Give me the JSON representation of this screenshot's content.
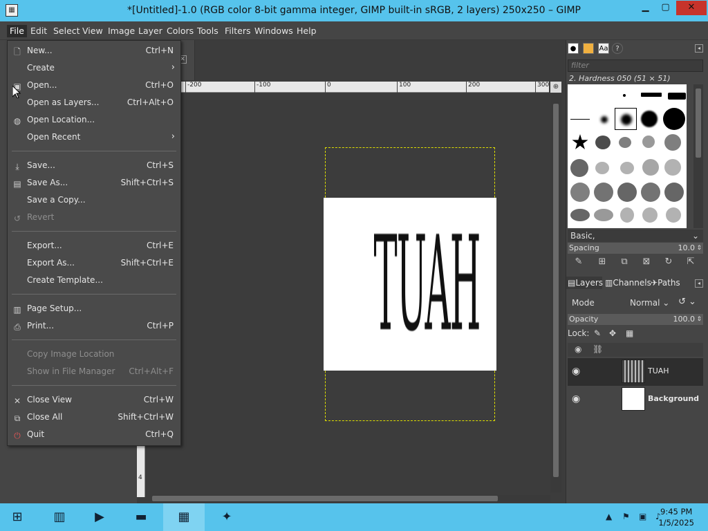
{
  "window": {
    "title": "*[Untitled]-1.0 (RGB color 8-bit gamma integer, GIMP built-in sRGB, 2 layers) 250x250 – GIMP",
    "minimize": "▁",
    "maximize": "▢",
    "close": "✕"
  },
  "menubar": [
    "File",
    "Edit",
    "Select",
    "View",
    "Image",
    "Layer",
    "Colors",
    "Tools",
    "Filters",
    "Windows",
    "Help"
  ],
  "file_menu": {
    "items": [
      {
        "label": "New...",
        "accel": "Ctrl+N",
        "icon": "new-image-icon"
      },
      {
        "label": "Create",
        "accel": "",
        "submenu": true
      },
      {
        "label": "Open...",
        "accel": "Ctrl+O",
        "icon": "open-icon"
      },
      {
        "label": "Open as Layers...",
        "accel": "Ctrl+Alt+O"
      },
      {
        "label": "Open Location...",
        "accel": "",
        "icon": "globe-icon"
      },
      {
        "label": "Open Recent",
        "accel": "",
        "submenu": true
      },
      {
        "label": "Save...",
        "accel": "Ctrl+S",
        "icon": "save-icon"
      },
      {
        "label": "Save As...",
        "accel": "Shift+Ctrl+S",
        "icon": "save-as-icon"
      },
      {
        "label": "Save a Copy...",
        "accel": ""
      },
      {
        "label": "Revert",
        "accel": "",
        "disabled": true,
        "icon": "revert-icon"
      },
      {
        "label": "Export...",
        "accel": "Ctrl+E"
      },
      {
        "label": "Export As...",
        "accel": "Shift+Ctrl+E"
      },
      {
        "label": "Create Template...",
        "accel": ""
      },
      {
        "label": "Page Setup...",
        "accel": "",
        "icon": "page-setup-icon"
      },
      {
        "label": "Print...",
        "accel": "Ctrl+P",
        "icon": "print-icon"
      },
      {
        "label": "Copy Image Location",
        "accel": "",
        "disabled": true
      },
      {
        "label": "Show in File Manager",
        "accel": "Ctrl+Alt+F",
        "disabled": true
      },
      {
        "label": "Close View",
        "accel": "Ctrl+W",
        "icon": "close-icon"
      },
      {
        "label": "Close All",
        "accel": "Shift+Ctrl+W",
        "icon": "close-all-icon"
      },
      {
        "label": "Quit",
        "accel": "Ctrl+Q",
        "icon": "quit-icon"
      }
    ],
    "submenu_glyph": "›"
  },
  "rulers": {
    "top": [
      "-200",
      "-100",
      "0",
      "100",
      "200",
      "300"
    ],
    "left_bottom": "4"
  },
  "image": {
    "text": "TUAH"
  },
  "brushes": {
    "filter_placeholder": "filter",
    "current_brush": "2. Hardness 050 (51 × 51)",
    "preset": "Basic,",
    "spacing_label": "Spacing",
    "spacing_value": "10.0"
  },
  "layers_panel": {
    "tabs": [
      "Layers",
      "Channels",
      "Paths"
    ],
    "mode_label": "Mode",
    "mode_value": "Normal",
    "opacity_label": "Opacity",
    "opacity_value": "100.0",
    "lock_label": "Lock:",
    "layers": [
      {
        "name": "TUAH",
        "selected": true
      },
      {
        "name": "Background",
        "selected": false
      }
    ]
  },
  "taskbar": {
    "time": "9:45 PM",
    "date": "1/5/2025"
  }
}
